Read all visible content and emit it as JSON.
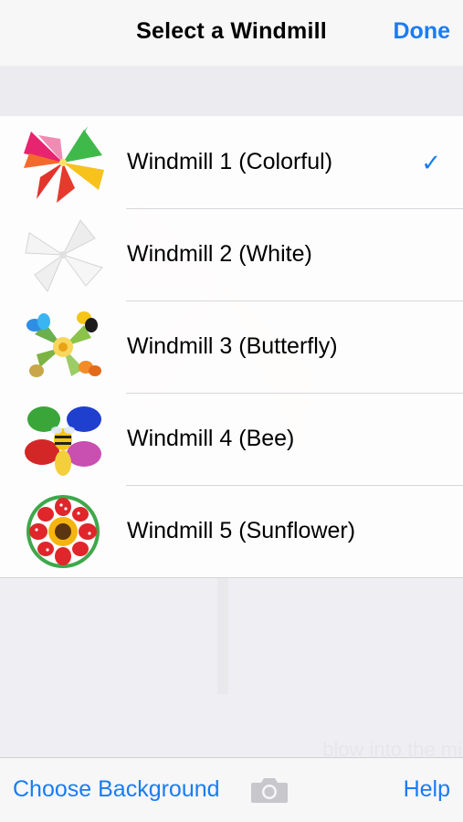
{
  "navbar": {
    "title": "Select a Windmill",
    "done_label": "Done"
  },
  "windmills": [
    {
      "label": "Windmill 1 (Colorful)",
      "icon": "colorful-windmill-icon",
      "selected": true
    },
    {
      "label": "Windmill 2 (White)",
      "icon": "white-windmill-icon",
      "selected": false
    },
    {
      "label": "Windmill 3 (Butterfly)",
      "icon": "butterfly-windmill-icon",
      "selected": false
    },
    {
      "label": "Windmill 4 (Bee)",
      "icon": "bee-windmill-icon",
      "selected": false
    },
    {
      "label": "Windmill 5 (Sunflower)",
      "icon": "sunflower-windmill-icon",
      "selected": false
    }
  ],
  "checkmark": "✓",
  "background_hint": "blow into the mic",
  "toolbar": {
    "choose_background_label": "Choose Background",
    "camera_icon": "camera-icon",
    "help_label": "Help"
  },
  "colors": {
    "accent": "#1a7cf3",
    "nav_background": "#f7f7f8",
    "grouped_background": "#efeff3"
  }
}
